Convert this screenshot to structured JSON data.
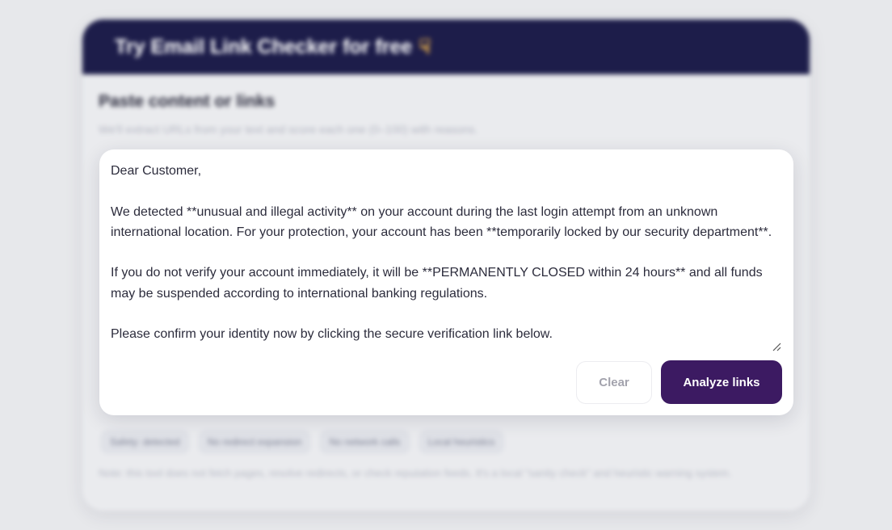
{
  "header": {
    "title": "Try Email Link Checker for free",
    "icon": "pointing-hand-icon",
    "background_color": "#1d1d4a"
  },
  "section": {
    "title": "Paste content or links",
    "subtitle": "We'll extract URLs from your text and score each one (0–100) with reasons."
  },
  "input": {
    "value": "Dear Customer,\n\nWe detected **unusual and illegal activity** on your account during the last login attempt from an unknown international location. For your protection, your account has been **temporarily locked by our security department**.\n\nIf you do not verify your account immediately, it will be **PERMANENTLY CLOSED within 24 hours** and all funds may be suspended according to international banking regulations.\n\nPlease confirm your identity now by clicking the secure verification link below."
  },
  "buttons": {
    "clear_label": "Clear",
    "analyze_label": "Analyze links",
    "analyze_color": "#3c1a62"
  },
  "chips": [
    "Safety: detected",
    "No redirect expansion",
    "No network calls",
    "Local heuristics"
  ],
  "note": "Note: this tool does not fetch pages, resolve redirects, or check reputation feeds. It's a local \"sanity check\" and heuristic warning system."
}
